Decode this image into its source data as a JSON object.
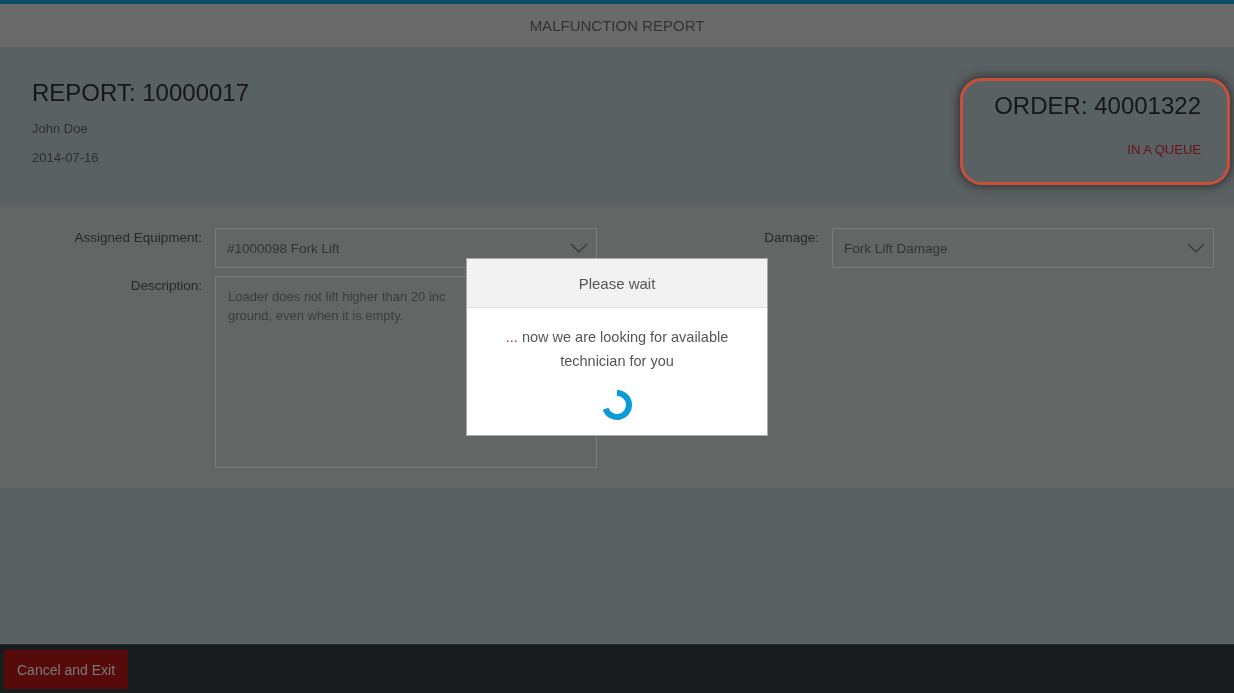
{
  "window": {
    "title": "MALFUNCTION REPORT"
  },
  "report": {
    "title": "REPORT: 10000017",
    "author": "John Doe",
    "date": "2014-07-16"
  },
  "order": {
    "title": "ORDER: 40001322",
    "status": "IN A QUEUE"
  },
  "form": {
    "fields": [
      {
        "kind": "dropdown",
        "label": "Assigned Equipment:",
        "value": "#1000098 Fork Lift"
      },
      {
        "kind": "dropdown",
        "label": "Damage:",
        "value": "Fork Lift Damage"
      },
      {
        "kind": "textarea",
        "label": "Description:",
        "lines": [
          "Loader does not lift higher than 20 inc",
          "ground, even when it is empty."
        ]
      }
    ]
  },
  "dialog": {
    "title": "Please wait",
    "message_prefix": "...",
    "message": "now we are looking for available technician for you"
  },
  "footer": {
    "buttons": [
      "Cancel and Exit"
    ]
  }
}
